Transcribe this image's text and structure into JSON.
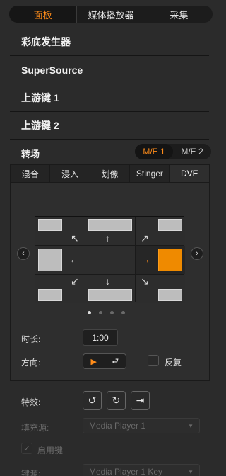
{
  "top_tabs": [
    "面板",
    "媒体播放器",
    "采集"
  ],
  "sections": {
    "color_generator": "彩底发生器",
    "supersource": "SuperSource",
    "upstream_key_1": "上游键 1",
    "upstream_key_2": "上游键 2"
  },
  "transition": {
    "label": "转场",
    "me_options": [
      "M/E 1",
      "M/E 2"
    ],
    "me_selected": "M/E 1",
    "tabs": [
      "混合",
      "浸入",
      "划像",
      "Stinger",
      "DVE"
    ],
    "active_tab": "DVE"
  },
  "dve": {
    "page_dots": 4,
    "active_dot": 0,
    "selected_direction": "push-right",
    "duration_label": "时长:",
    "duration_value": "1:00",
    "direction_label": "方向:",
    "reverse_label": "反复",
    "effects_label": "特效:",
    "fill_source_label": "填充源:",
    "fill_source_value": "Media Player 1",
    "enable_key_label": "启用键",
    "key_source_label": "键源:",
    "key_source_value": "Media Player 1 Key"
  },
  "colors": {
    "accent": "#ff8c1a",
    "background": "#2b2b2b",
    "disabled_text": "#6a6a6a"
  }
}
